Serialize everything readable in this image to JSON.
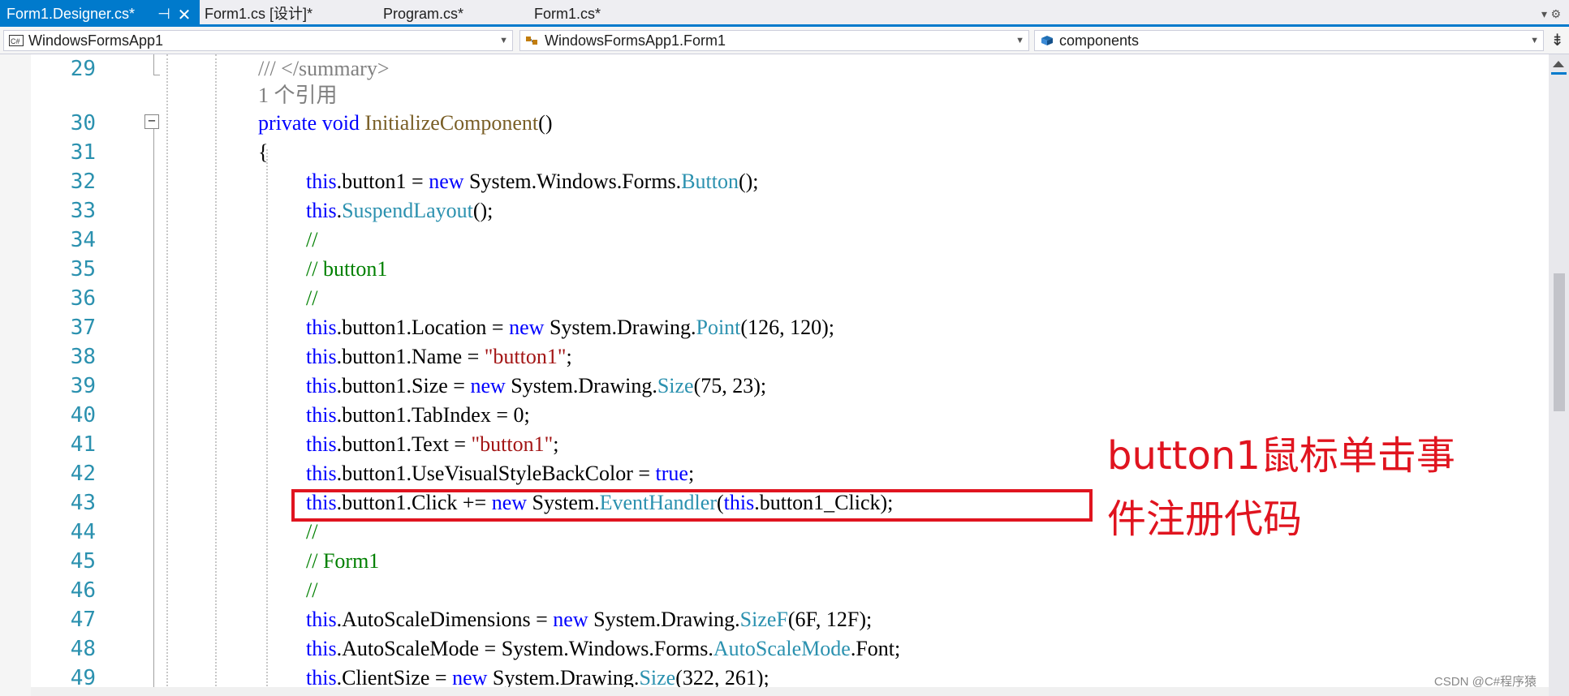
{
  "tabs": [
    {
      "label": "Form1.Designer.cs*",
      "active": true
    },
    {
      "label": "Form1.cs [设计]*",
      "active": false
    },
    {
      "label": "Program.cs*",
      "active": false
    },
    {
      "label": "Form1.cs*",
      "active": false
    }
  ],
  "tab_pin_glyph": "⊣",
  "tab_close_glyph": "✕",
  "navbar": {
    "project": "WindowsFormsApp1",
    "class": "WindowsFormsApp1.Form1",
    "member": "components"
  },
  "code_lines": [
    {
      "num": "29",
      "text": "/// </summary>"
    },
    {
      "num": "",
      "text": "1 个引用"
    },
    {
      "num": "30",
      "text": "private void InitializeComponent()"
    },
    {
      "num": "31",
      "text": "{"
    },
    {
      "num": "32",
      "text": "this.button1 = new System.Windows.Forms.Button();"
    },
    {
      "num": "33",
      "text": "this.SuspendLayout();"
    },
    {
      "num": "34",
      "text": "//"
    },
    {
      "num": "35",
      "text": "// button1"
    },
    {
      "num": "36",
      "text": "//"
    },
    {
      "num": "37",
      "text": "this.button1.Location = new System.Drawing.Point(126, 120);"
    },
    {
      "num": "38",
      "text": "this.button1.Name = \"button1\";"
    },
    {
      "num": "39",
      "text": "this.button1.Size = new System.Drawing.Size(75, 23);"
    },
    {
      "num": "40",
      "text": "this.button1.TabIndex = 0;"
    },
    {
      "num": "41",
      "text": "this.button1.Text = \"button1\";"
    },
    {
      "num": "42",
      "text": "this.button1.UseVisualStyleBackColor = true;"
    },
    {
      "num": "43",
      "text": "this.button1.Click += new System.EventHandler(this.button1_Click);"
    },
    {
      "num": "44",
      "text": "//"
    },
    {
      "num": "45",
      "text": "// Form1"
    },
    {
      "num": "46",
      "text": "//"
    },
    {
      "num": "47",
      "text": "this.AutoScaleDimensions = new System.Drawing.SizeF(6F, 12F);"
    },
    {
      "num": "48",
      "text": "this.AutoScaleMode = System.Windows.Forms.AutoScaleMode.Font;"
    },
    {
      "num": "49",
      "text": "this.ClientSize = new System.Drawing.Size(322, 261);"
    }
  ],
  "annotation": {
    "line1": "button1鼠标单击事",
    "line2": "件注册代码"
  },
  "watermark": "CSDN @C#程序猿",
  "colors": {
    "accent": "#007acc",
    "keyword": "#0000ff",
    "type": "#2b91af",
    "comment": "#008000",
    "string": "#a31515",
    "highlight": "#e0141f"
  }
}
